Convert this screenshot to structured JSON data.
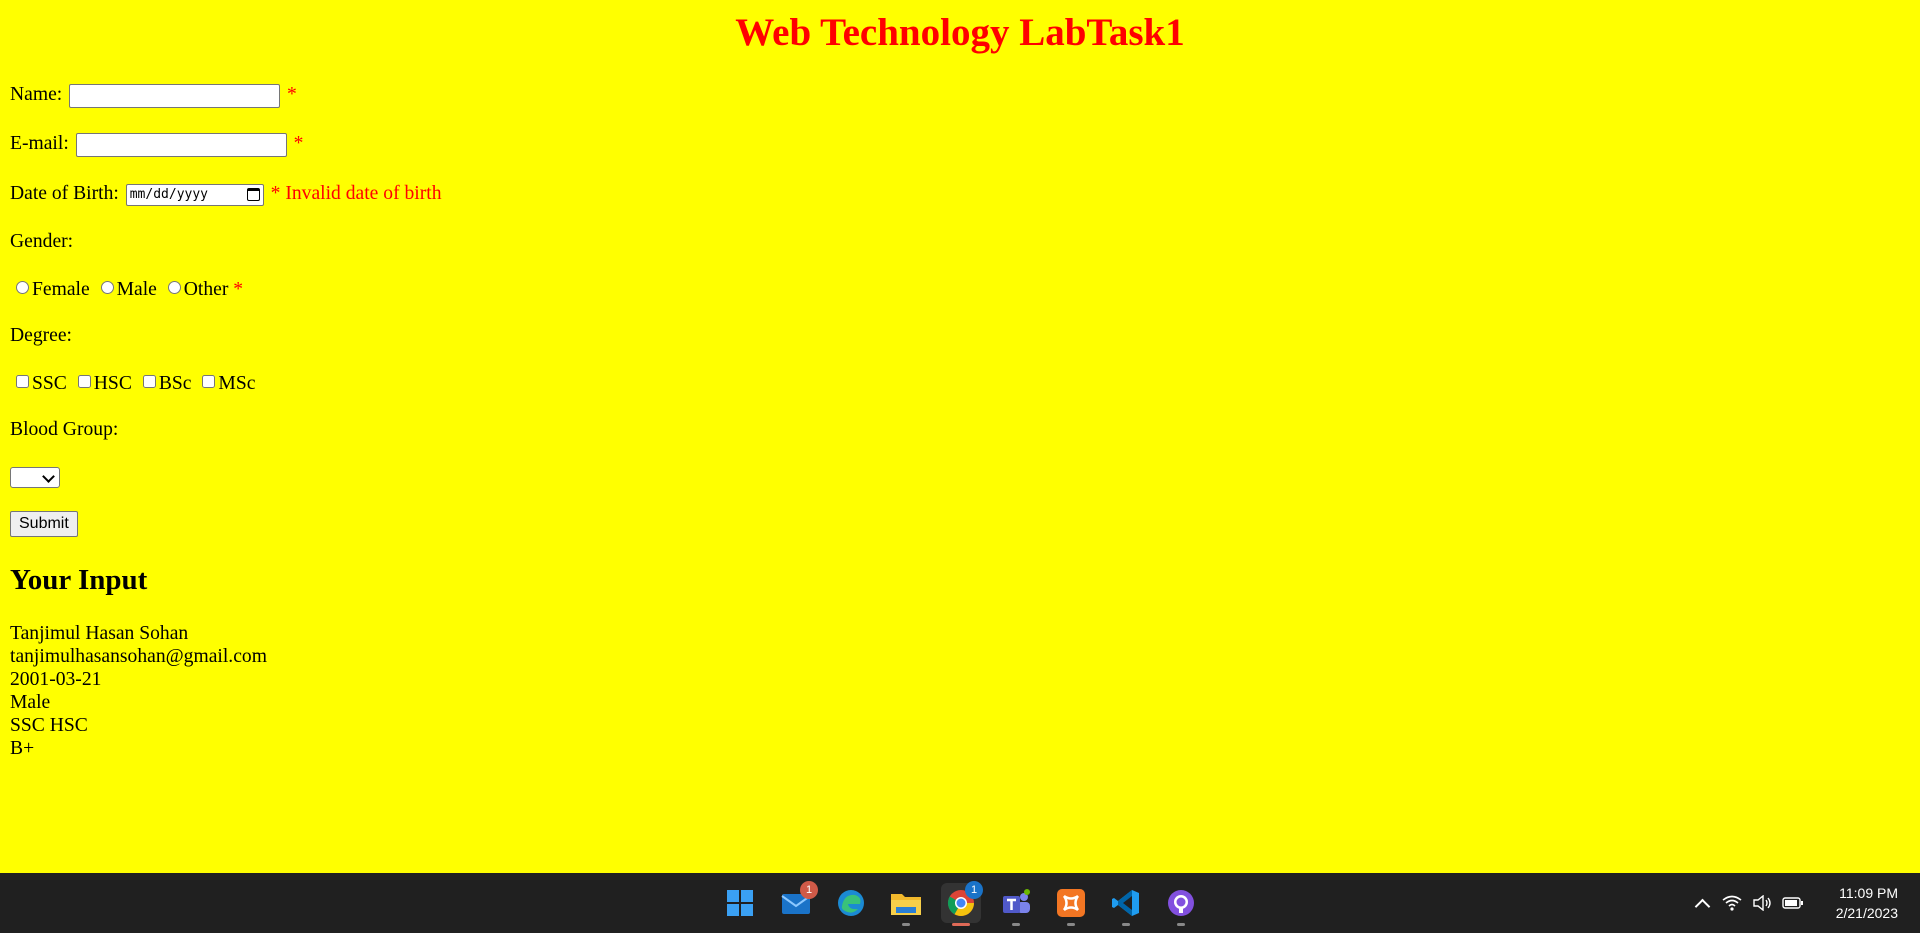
{
  "page": {
    "title": "Web Technology LabTask1",
    "name_label": "Name:",
    "email_label": "E-mail:",
    "dob_label": "Date of Birth:",
    "dob_placeholder": "mm/dd/yyyy",
    "dob_error": "* Invalid date of birth",
    "required_mark": "*",
    "gender_label": "Gender:",
    "gender_options": [
      "Female",
      "Male",
      "Other"
    ],
    "degree_label": "Degree:",
    "degree_options": [
      "SSC",
      "HSC",
      "BSc",
      "MSc"
    ],
    "blood_label": "Blood Group:",
    "blood_selected": "",
    "submit_label": "Submit",
    "output_heading": "Your Input",
    "output": {
      "name": "Tanjimul Hasan Sohan",
      "email": "tanjimulhasansohan@gmail.com",
      "dob": "2001-03-21",
      "gender": "Male",
      "degree": "SSC HSC",
      "blood": "B+"
    }
  },
  "taskbar": {
    "apps": [
      {
        "name": "start",
        "icon": "windows-start-icon"
      },
      {
        "name": "mail",
        "icon": "mail-icon",
        "badge": "1"
      },
      {
        "name": "edge",
        "icon": "edge-icon"
      },
      {
        "name": "file-explorer",
        "icon": "folder-icon"
      },
      {
        "name": "chrome",
        "icon": "chrome-icon",
        "badge": "1",
        "active": true
      },
      {
        "name": "teams",
        "icon": "teams-icon"
      },
      {
        "name": "xampp",
        "icon": "xampp-icon"
      },
      {
        "name": "vscode",
        "icon": "vscode-icon"
      },
      {
        "name": "github-desktop",
        "icon": "github-icon"
      }
    ],
    "time": "11:09 PM",
    "date": "2/21/2023",
    "colors": {
      "background": "#202020",
      "accent": "#e06a57"
    }
  },
  "colors": {
    "page_background": "#ffff00",
    "title": "#ff0000",
    "error": "#ff0000"
  }
}
